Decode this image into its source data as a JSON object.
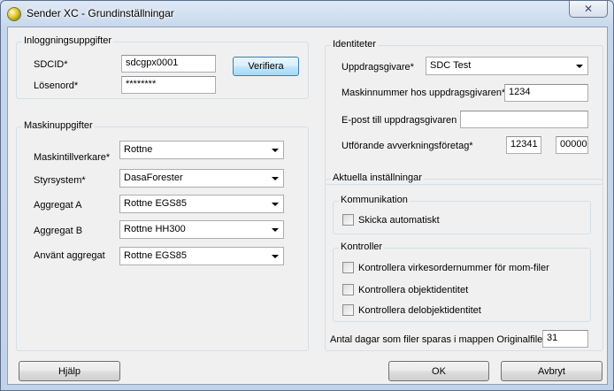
{
  "window": {
    "title": "Sender XC - Grundinställningar",
    "close_glyph": "✕"
  },
  "login": {
    "title": "Inloggningsuppgifter",
    "sdcid_label": "SDCID*",
    "sdcid_value": "sdcgpx0001",
    "password_label": "Lösenord*",
    "password_value": "********",
    "verify_label": "Verifiera"
  },
  "machine": {
    "title": "Maskinuppgifter",
    "manufacturer_label": "Maskintillverkare*",
    "manufacturer_value": "Rottne",
    "control_label": "Styrsystem*",
    "control_value": "DasaForester",
    "aggA_label": "Aggregat A",
    "aggA_value": "Rottne EGS85",
    "aggB_label": "Aggregat B",
    "aggB_value": "Rottne HH300",
    "used_label": "Använt aggregat",
    "used_value": "Rottne EGS85"
  },
  "identities": {
    "title": "Identiteter",
    "client_label": "Uppdragsgivare*",
    "client_value": "SDC Test",
    "machine_no_label": "Maskinnummer hos uppdragsgivaren*",
    "machine_no_value": "1234",
    "email_label": "E-post till uppdragsgivaren",
    "email_value": "",
    "company_label": "Utförande avverkningsföretag*",
    "company_value1": "12341",
    "company_value2": "00000"
  },
  "settings": {
    "title": "Aktuella inställningar",
    "communication_title": "Kommunikation",
    "auto_send_label": "Skicka automatiskt",
    "controls_title": "Kontroller",
    "check1_label": "Kontrollera virkesordernummer för mom-filer",
    "check2_label": "Kontrollera objektidentitet",
    "check3_label": "Kontrollera delobjektidentitet",
    "days_label": "Antal dagar som filer sparas i mappen Originalfiler:",
    "days_value": "31"
  },
  "buttons": {
    "help": "Hjälp",
    "ok": "OK",
    "cancel": "Avbryt"
  }
}
